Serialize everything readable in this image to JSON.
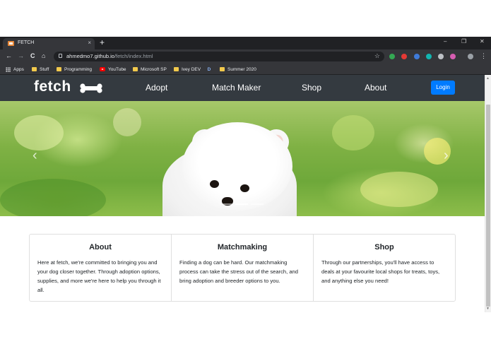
{
  "browser": {
    "tab_title": "FETCH",
    "tab_close": "×",
    "new_tab": "+",
    "window_controls": {
      "minimize": "–",
      "restore": "❐",
      "close": "✕"
    },
    "nav": {
      "back": "←",
      "forward": "→",
      "reload": "C",
      "home": "⌂"
    },
    "url_host": "ahmedmo7.github.io",
    "url_path": "/fetch/index.html",
    "bookmark_star": "☆",
    "extension_colors": [
      "#34a853",
      "#e53935",
      "#3f7bd9",
      "#12b5b0",
      "#bdc1c6",
      "#d65db1",
      "#9aa0a6"
    ],
    "menu": "⋮",
    "bookmarks": [
      {
        "label": "Apps",
        "icon": "apps-grid-icon"
      },
      {
        "label": "Stuff",
        "icon": "folder-icon"
      },
      {
        "label": "Programming",
        "icon": "folder-icon"
      },
      {
        "label": "YouTube",
        "icon": "youtube-icon"
      },
      {
        "label": "Microsoft SP",
        "icon": "folder-icon"
      },
      {
        "label": "Ivey DEV",
        "icon": "folder-icon"
      },
      {
        "label": "",
        "icon": "d-icon",
        "glyph": "D"
      },
      {
        "label": "Summer 2020",
        "icon": "folder-icon"
      }
    ]
  },
  "site": {
    "logo": "fetch",
    "nav_links": [
      "Adopt",
      "Match Maker",
      "Shop",
      "About"
    ],
    "login_label": "Login",
    "carousel": {
      "prev": "‹",
      "next": "›",
      "slide_count": 3,
      "active_slide": 1
    },
    "cards": [
      {
        "title": "About",
        "text": "Here at fetch, we're committed to bringing you and your dog closer together. Through adoption options, supplies, and more we're here to help you through it all."
      },
      {
        "title": "Matchmaking",
        "text": "Finding a dog can be hard. Our matchmaking process can take the stress out of the search, and bring adoption and breeder options to you."
      },
      {
        "title": "Shop",
        "text": "Through our partnerships, you'll have access to deals at your favourite local shops for treats, toys, and anything else you need!"
      }
    ]
  },
  "colors": {
    "navbar": "#343a40",
    "login_button": "#007bff",
    "chrome_dark": "#202124",
    "chrome_toolbar": "#35363a"
  }
}
